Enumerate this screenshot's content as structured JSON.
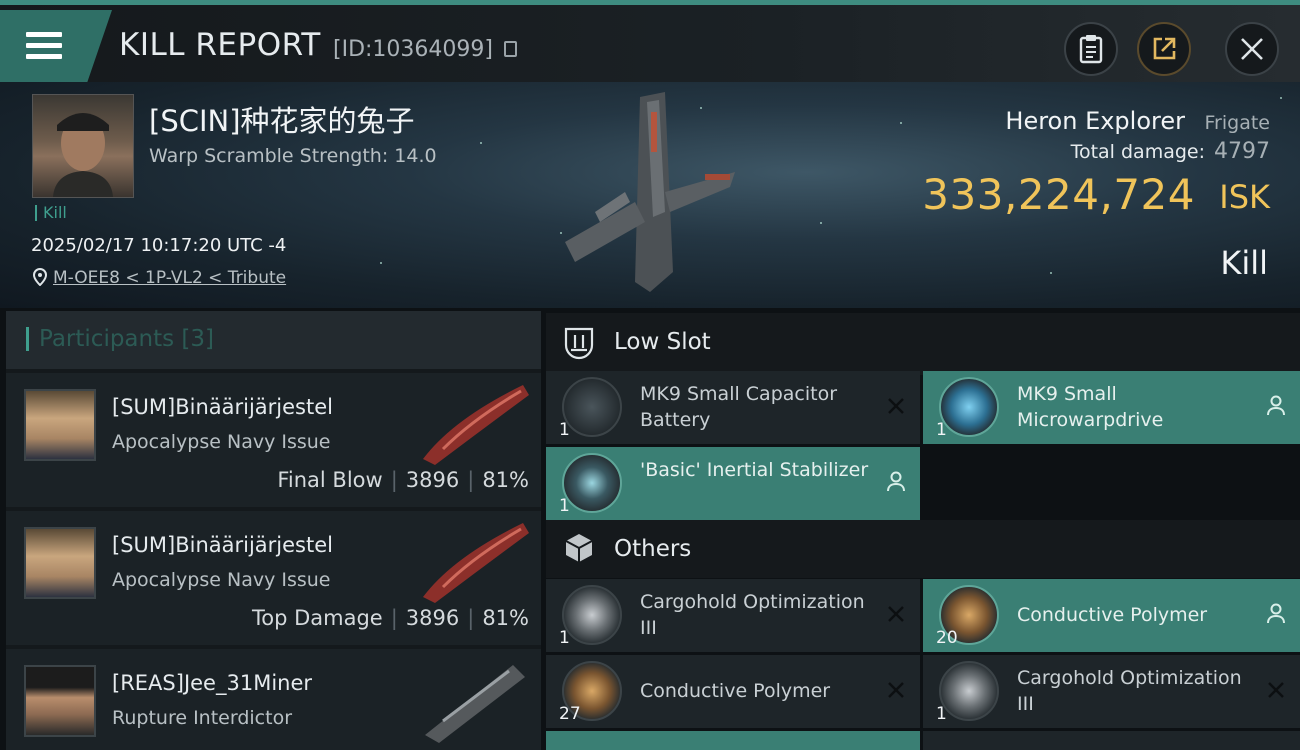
{
  "header": {
    "title": "KILL REPORT",
    "kill_id": "[ID:10364099]"
  },
  "victim": {
    "name": "[SCIN]种花家的兔子",
    "warp_scramble": "Warp Scramble Strength: 14.0",
    "tag": "Kill",
    "datetime": "2025/02/17 10:17:20 UTC -4",
    "location": "M-OEE8 < 1P-VL2 < Tribute"
  },
  "ship": {
    "name": "Heron Explorer",
    "class": "Frigate",
    "total_damage_label": "Total damage:",
    "total_damage": "4797",
    "isk_value": "333,224,724",
    "isk_unit": "ISK",
    "result": "Kill"
  },
  "participants": {
    "title": "Participants [3]",
    "rows": [
      {
        "name": "[SUM]Binäärijärjestel",
        "ship": "Apocalypse Navy Issue",
        "role": "Final Blow",
        "damage": "3896",
        "percent": "81%"
      },
      {
        "name": "[SUM]Binäärijärjestel",
        "ship": "Apocalypse Navy Issue",
        "role": "Top Damage",
        "damage": "3896",
        "percent": "81%"
      },
      {
        "name": "[REAS]Jee_31Miner",
        "ship": "Rupture Interdictor"
      }
    ]
  },
  "low_slot": {
    "title": "Low Slot",
    "items": [
      {
        "name": "MK9 Small Capacitor Battery",
        "qty": "1",
        "status": "destroyed",
        "icon": "capacitor-battery-icon"
      },
      {
        "name": "MK9 Small Microwarpdrive",
        "qty": "1",
        "status": "dropped",
        "icon": "microwarpdrive-icon"
      },
      {
        "name": "'Basic' Inertial Stabilizer",
        "qty": "1",
        "status": "dropped",
        "icon": "inertial-stabilizer-icon"
      }
    ]
  },
  "others": {
    "title": "Others",
    "items": [
      {
        "name": "Cargohold Optimization III",
        "qty": "1",
        "status": "destroyed",
        "icon": "cargohold-rig-icon"
      },
      {
        "name": "Conductive Polymer",
        "qty": "20",
        "status": "dropped",
        "icon": "polymer-crate-icon"
      },
      {
        "name": "Conductive Polymer",
        "qty": "27",
        "status": "destroyed",
        "icon": "polymer-crate-icon"
      },
      {
        "name": "Cargohold Optimization III",
        "qty": "1",
        "status": "destroyed",
        "icon": "cargohold-rig-icon"
      }
    ]
  },
  "colors": {
    "accent": "#3f9f8e",
    "isk": "#f0c45a",
    "dropped": "#3a7f74"
  }
}
